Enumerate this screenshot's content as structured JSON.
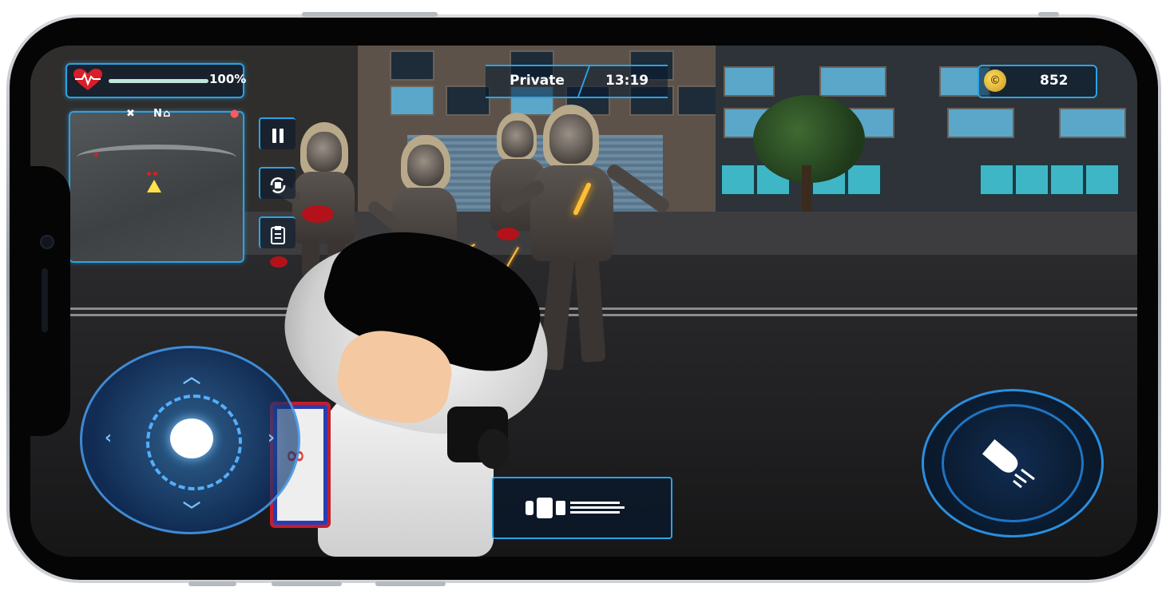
{
  "hud": {
    "health_percent_label": "100%",
    "health_level": 1.0,
    "rank": "Private",
    "timer": "13:19",
    "coins": "852",
    "minimap": {
      "markers": [
        "✖",
        "N",
        "⌂",
        "●"
      ]
    }
  },
  "controls": {
    "pause_icon": "pause-icon",
    "camera_icon": "rotate-camera-icon",
    "tasks_icon": "clipboard-icon",
    "joystick_icon": "movement-joystick",
    "weapon_icon": "minigun-icon",
    "fire_icon": "bullet-icon"
  },
  "backpack_logo": "∞",
  "colors": {
    "accent": "#2aa3e6",
    "health": "#bfe6d8",
    "heart": "#d81e2a",
    "coin": "#f3c52a"
  }
}
